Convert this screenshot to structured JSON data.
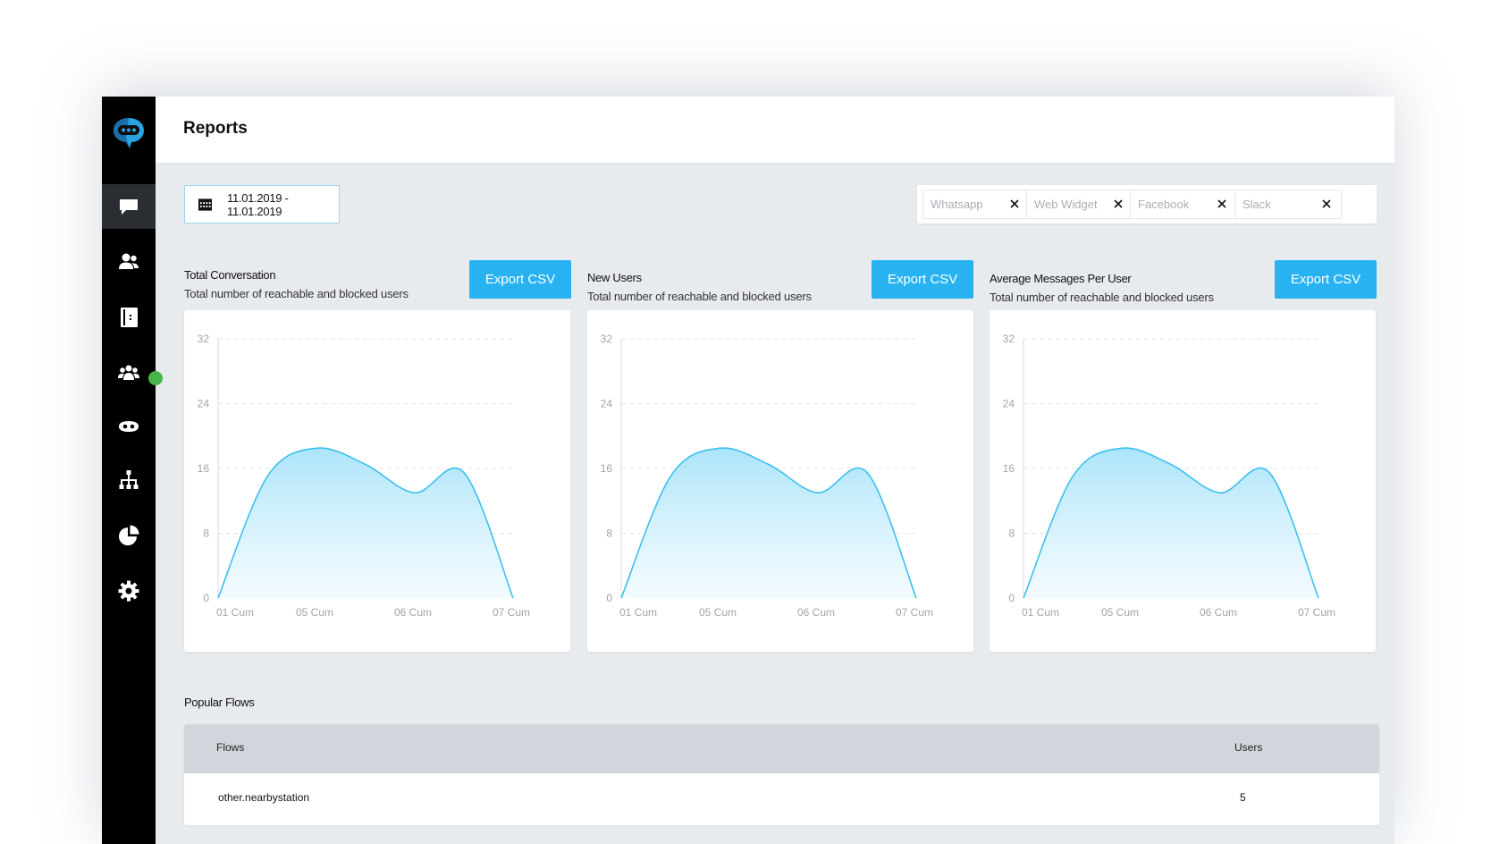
{
  "header": {
    "title": "Reports"
  },
  "date_range": {
    "label": "11.01.2019 - 11.01.2019"
  },
  "channel_filters": [
    {
      "label": "Whatsapp"
    },
    {
      "label": "Web Widget"
    },
    {
      "label": "Facebook"
    },
    {
      "label": "Slack"
    }
  ],
  "cards": [
    {
      "title": "Total Conversation",
      "subtitle": "Total number of reachable and blocked users",
      "export_label": "Export CSV"
    },
    {
      "title": "New Users",
      "subtitle": "Total number of reachable and blocked users",
      "export_label": "Export CSV"
    },
    {
      "title": "Average Messages Per User",
      "subtitle": "Total number of reachable and blocked users",
      "export_label": "Export CSV"
    }
  ],
  "chart_data": [
    {
      "type": "area",
      "title": "Total Conversation",
      "x": [
        "01 Cum",
        "",
        "05 Cum",
        "",
        "06 Cum",
        "",
        "07 Cum"
      ],
      "x_ticks": [
        "01 Cum",
        "05 Cum",
        "06 Cum",
        "07 Cum"
      ],
      "y_ticks": [
        0,
        8,
        16,
        24,
        32
      ],
      "ylim": [
        0,
        32
      ],
      "grid": true,
      "color": "#3cc0ef",
      "series": [
        {
          "values": [
            0,
            15,
            18.5,
            16.5,
            13,
            15.5,
            0
          ]
        }
      ]
    },
    {
      "type": "area",
      "title": "New Users",
      "x": [
        "01 Cum",
        "",
        "05 Cum",
        "",
        "06 Cum",
        "",
        "07 Cum"
      ],
      "x_ticks": [
        "01 Cum",
        "05 Cum",
        "06 Cum",
        "07 Cum"
      ],
      "y_ticks": [
        0,
        8,
        16,
        24,
        32
      ],
      "ylim": [
        0,
        32
      ],
      "grid": true,
      "color": "#3cc0ef",
      "series": [
        {
          "values": [
            0,
            15,
            18.5,
            16.5,
            13,
            15.5,
            0
          ]
        }
      ]
    },
    {
      "type": "area",
      "title": "Average Messages Per User",
      "x": [
        "01 Cum",
        "",
        "05 Cum",
        "",
        "06 Cum",
        "",
        "07 Cum"
      ],
      "x_ticks": [
        "01 Cum",
        "05 Cum",
        "06 Cum",
        "07 Cum"
      ],
      "y_ticks": [
        0,
        8,
        16,
        24,
        32
      ],
      "ylim": [
        0,
        32
      ],
      "grid": true,
      "color": "#3cc0ef",
      "series": [
        {
          "values": [
            0,
            15,
            18.5,
            16.5,
            13,
            15.5,
            0
          ]
        }
      ]
    }
  ],
  "popular_flows": {
    "title": "Popular Flows",
    "columns": [
      "Flows",
      "Users"
    ],
    "rows": [
      {
        "flow": "other.nearbystation",
        "users": "5"
      }
    ]
  },
  "sidebar": {
    "icons": [
      "chat-icon",
      "users-icon",
      "contacts-book-icon",
      "team-icon",
      "bot-icon",
      "flow-tree-icon",
      "pie-chart-icon",
      "gear-icon"
    ]
  },
  "colors": {
    "accent": "#29b2f2",
    "online": "#48b54a",
    "sidebar": "#000000"
  }
}
